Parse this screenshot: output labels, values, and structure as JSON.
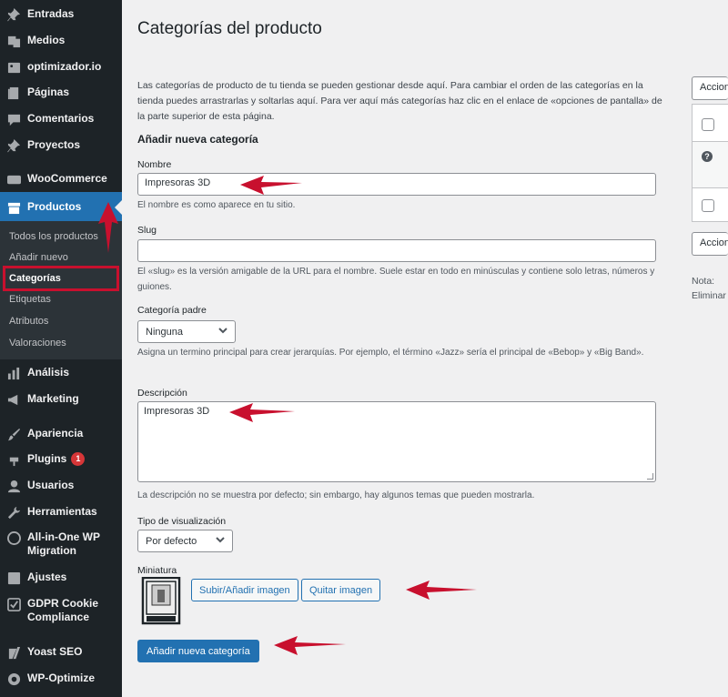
{
  "sidebar": {
    "items": [
      {
        "label": "Entradas",
        "icon": "pin-icon"
      },
      {
        "label": "Medios",
        "icon": "media-icon"
      },
      {
        "label": "optimizador.io",
        "icon": "image-icon"
      },
      {
        "label": "Páginas",
        "icon": "pages-icon"
      },
      {
        "label": "Comentarios",
        "icon": "comment-icon"
      },
      {
        "label": "Proyectos",
        "icon": "pin-icon"
      },
      {
        "label": "WooCommerce",
        "icon": "woo-icon"
      },
      {
        "label": "Productos",
        "icon": "archive-icon"
      },
      {
        "label": "Análisis",
        "icon": "chart-icon"
      },
      {
        "label": "Marketing",
        "icon": "megaphone-icon"
      },
      {
        "label": "Apariencia",
        "icon": "brush-icon"
      },
      {
        "label": "Plugins",
        "icon": "plugin-icon",
        "badge": "1"
      },
      {
        "label": "Usuarios",
        "icon": "user-icon"
      },
      {
        "label": "Herramientas",
        "icon": "wrench-icon"
      },
      {
        "label": "All-in-One WP Migration",
        "icon": "migration-icon"
      },
      {
        "label": "Ajustes",
        "icon": "settings-icon"
      },
      {
        "label": "GDPR Cookie Compliance",
        "icon": "check-icon"
      },
      {
        "label": "Yoast SEO",
        "icon": "yoast-icon"
      },
      {
        "label": "WP-Optimize",
        "icon": "optimize-icon"
      }
    ],
    "submenu": [
      {
        "label": "Todos los productos"
      },
      {
        "label": "Añadir nuevo"
      },
      {
        "label": "Categorías"
      },
      {
        "label": "Etiquetas"
      },
      {
        "label": "Atributos"
      },
      {
        "label": "Valoraciones"
      }
    ],
    "active_color": "#2271b1",
    "bg_color": "#1d2327"
  },
  "main": {
    "title": "Categorías del producto",
    "intro": "Las categorías de producto de tu tienda se pueden gestionar desde aquí. Para cambiar el orden de las categorías en la tienda puedes arrastrarlas y soltarlas aquí. Para ver aquí más categorías haz clic en el enlace de «opciones de pantalla» de la parte superior de esta página.",
    "section_title": "Añadir nueva categoría",
    "name": {
      "label": "Nombre",
      "value": "Impresoras 3D",
      "help": "El nombre es como aparece en tu sitio."
    },
    "slug": {
      "label": "Slug",
      "value": "",
      "help": "El «slug» es la versión amigable de la URL para el nombre. Suele estar en todo en minúsculas y contiene solo letras, números y guiones."
    },
    "parent": {
      "label": "Categoría padre",
      "value": "Ninguna",
      "help": "Asigna un termino principal para crear jerarquías. Por ejemplo, el término «Jazz» sería el principal de «Bebop» y «Big Band»."
    },
    "description": {
      "label": "Descripción",
      "value": "Impresoras 3D",
      "help": "La descripción no se muestra por defecto; sin embargo, hay algunos temas que pueden mostrarla."
    },
    "display_type": {
      "label": "Tipo de visualización",
      "value": "Por defecto"
    },
    "thumbnail": {
      "label": "Miniatura",
      "upload_label": "Subir/Añadir imagen",
      "remove_label": "Quitar imagen"
    },
    "submit_label": "Añadir nueva categoría"
  },
  "right_panel": {
    "bulk_actions_top": "Acciones en lote",
    "bulk_actions_bottom": "Acciones en lote",
    "note_label": "Nota:",
    "note_text": "Eliminar"
  },
  "annotation_color": "#c8102e"
}
